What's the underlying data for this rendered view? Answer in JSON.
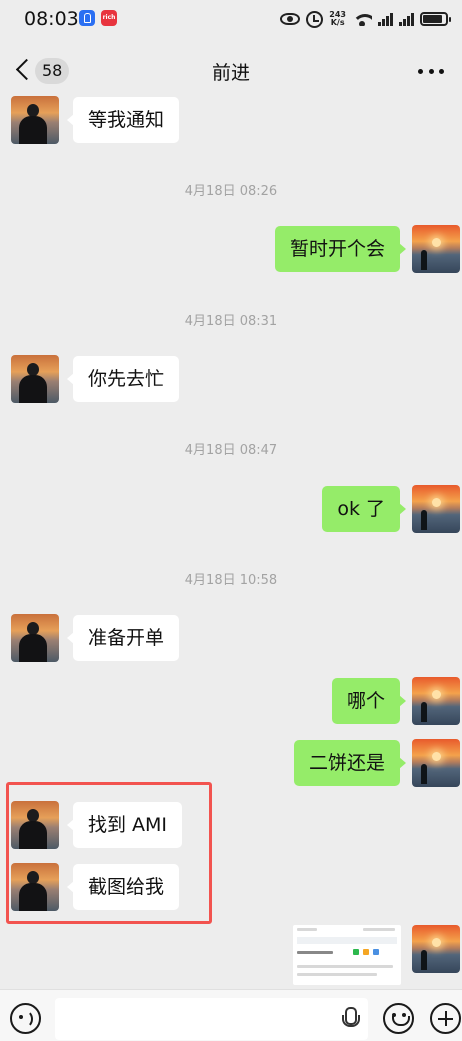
{
  "status_bar": {
    "time": "08:03",
    "app_badge": "rich",
    "net_speed": "243\nK/s",
    "signal_1_label": "4G",
    "signal_2_label": "3G"
  },
  "nav": {
    "unread_count": "58",
    "title": "前进"
  },
  "messages": [
    {
      "side": "left",
      "text": "等我通知"
    },
    {
      "time": "4月18日 08:26"
    },
    {
      "side": "right",
      "text": "暂时开个会"
    },
    {
      "time": "4月18日 08:31"
    },
    {
      "side": "left",
      "text": "你先去忙"
    },
    {
      "time": "4月18日 08:47"
    },
    {
      "side": "right",
      "text": "ok 了"
    },
    {
      "time": "4月18日 10:58"
    },
    {
      "side": "left",
      "text": "准备开单"
    },
    {
      "side": "right",
      "text": "哪个"
    },
    {
      "side": "right",
      "text": "二饼还是"
    },
    {
      "side": "left",
      "text": "找到 AMI"
    },
    {
      "side": "left",
      "text": "截图给我"
    },
    {
      "side": "right",
      "type": "image"
    }
  ],
  "colors": {
    "background": "#ededed",
    "sent_bubble": "#95ec69",
    "received_bubble": "#ffffff",
    "highlight_box": "#f2534f"
  },
  "icons": [
    "back-icon",
    "more-icon",
    "voice-icon",
    "mic-icon",
    "emoji-icon",
    "plus-icon"
  ]
}
